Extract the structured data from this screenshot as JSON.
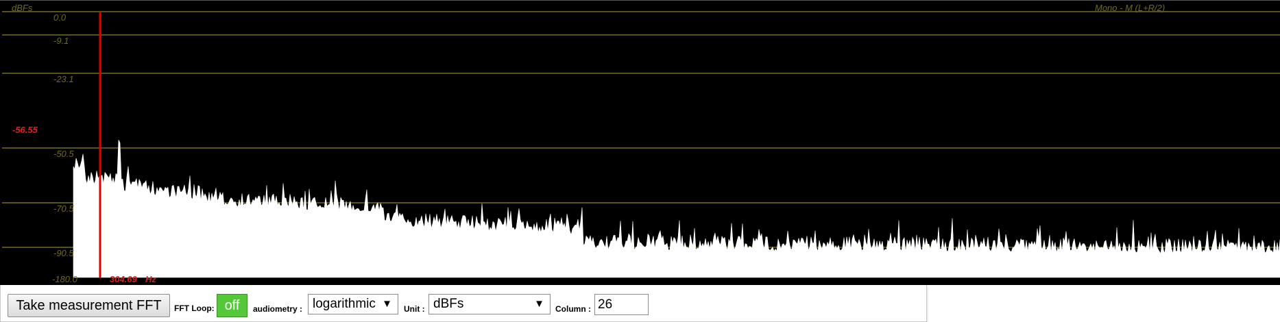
{
  "spectrum": {
    "unit_label": "dBFs",
    "channel_label": "Mono - M (L+R/2)",
    "grid_lines": [
      {
        "label": "0.0",
        "db": 0.0
      },
      {
        "label": "-9.1",
        "db": -9.1
      },
      {
        "label": "-23.1",
        "db": -23.1
      },
      {
        "label": "-50.5",
        "db": -50.5
      },
      {
        "label": "-70.5",
        "db": -70.5
      },
      {
        "label": "-90.5",
        "db": -90.5
      }
    ],
    "bottom_label": "-180.0",
    "cursor": {
      "level_label": "-56.55",
      "freq_value": "304.69",
      "freq_unit": "Hz",
      "color": "#e00000"
    },
    "grid_color": "#57521a",
    "trace_color": "#ffffff"
  },
  "toolbar": {
    "measure_button": "Take measurement FFT",
    "fft_loop_label": "FFT Loop:",
    "fft_loop_state": "off",
    "fft_loop_color": "#55c83a",
    "audiometry_label": "audiometry :",
    "audiometry_value": "logarithmic",
    "unit_label": "Unit :",
    "unit_value": "dBFs",
    "column_label": "Column :",
    "column_value": "26"
  }
}
